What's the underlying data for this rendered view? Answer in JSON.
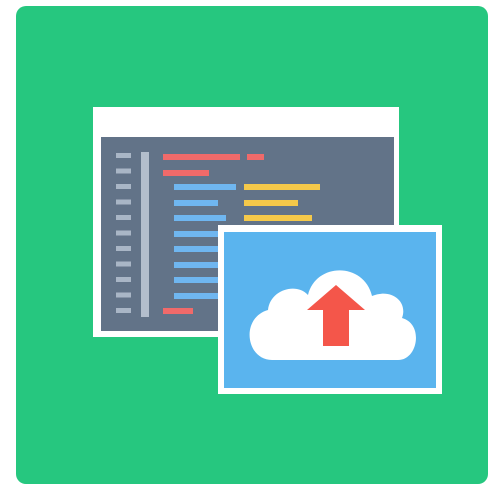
{
  "colors": {
    "tile_background": "#26C77F",
    "window_frame": "#FFFFFF",
    "window_titlebar": "#FFFFFF",
    "editor_background": "#627388",
    "line_number_mark": "#A9B6C6",
    "gutter": "#B3BECC",
    "code_red": "#F06A6A",
    "code_blue": "#6FB6F0",
    "code_yellow": "#F5C94A",
    "preview_background": "#5AB4EE",
    "cloud": "#FFFFFF",
    "upload_arrow": "#F4564A"
  },
  "icons": {
    "main": "code-upload-icon",
    "editor": "code-editor-window-icon",
    "preview": "cloud-upload-icon",
    "arrow": "upload-arrow-icon"
  }
}
